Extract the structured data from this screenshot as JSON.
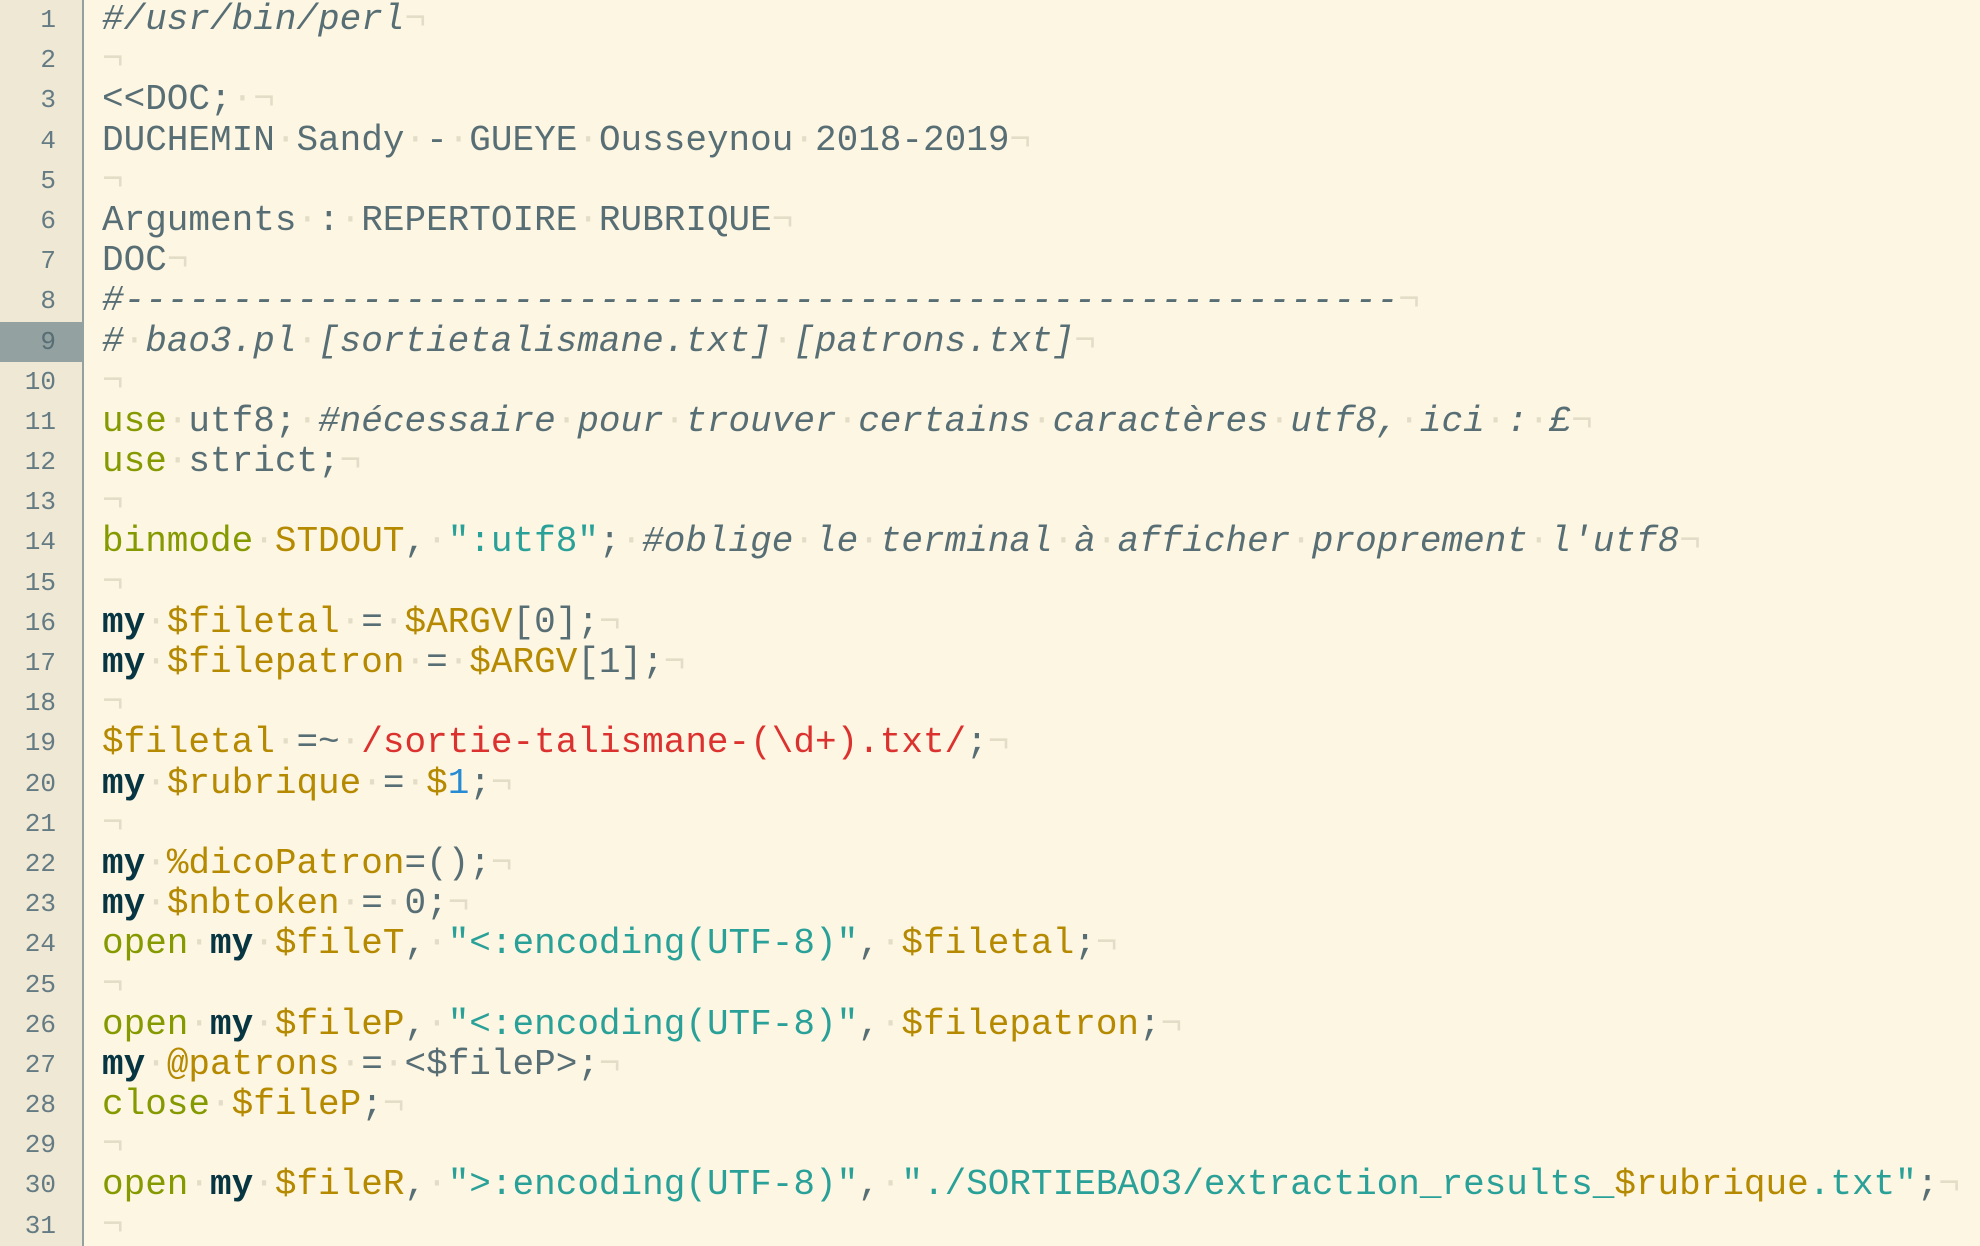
{
  "editor": {
    "current_line": 9,
    "invisible_space_glyph": "·",
    "invisible_eol_glyph": "¬",
    "colors": {
      "background": "#fdf6e3",
      "gutter": "#eee8d5",
      "current_line_gutter": "#93a1a1",
      "text": "#586e75",
      "keyword": "#859900",
      "declaration": "#073642",
      "variable": "#b58900",
      "string": "#2aa198",
      "regex": "#dc322f",
      "number": "#268bd2"
    },
    "lines": [
      [
        [
          "comment",
          "#/usr/bin/perl"
        ]
      ],
      [],
      [
        [
          "plain",
          "<<DOC; "
        ]
      ],
      [
        [
          "plain",
          "DUCHEMIN Sandy - GUEYE Ousseynou 2018-2019"
        ]
      ],
      [],
      [
        [
          "plain",
          "Arguments : REPERTOIRE RUBRIQUE"
        ]
      ],
      [
        [
          "plain",
          "DOC"
        ]
      ],
      [
        [
          "comment",
          "#-----------------------------------------------------------"
        ]
      ],
      [
        [
          "comment",
          "# bao3.pl [sortietalismane.txt] [patrons.txt]"
        ]
      ],
      [],
      [
        [
          "kw",
          "use"
        ],
        [
          "plain",
          " utf8; "
        ],
        [
          "comment",
          "#nécessaire pour trouver certains caractères utf8, ici : £"
        ]
      ],
      [
        [
          "kw",
          "use"
        ],
        [
          "plain",
          " strict;"
        ]
      ],
      [],
      [
        [
          "kw",
          "binmode"
        ],
        [
          "plain",
          " "
        ],
        [
          "var",
          "STDOUT"
        ],
        [
          "plain",
          ", "
        ],
        [
          "str",
          "\":utf8\""
        ],
        [
          "plain",
          "; "
        ],
        [
          "comment",
          "#oblige le terminal à afficher proprement l'utf8"
        ]
      ],
      [],
      [
        [
          "my",
          "my"
        ],
        [
          "plain",
          " "
        ],
        [
          "var",
          "$filetal"
        ],
        [
          "plain",
          " = "
        ],
        [
          "var",
          "$ARGV"
        ],
        [
          "plain",
          "[0];"
        ]
      ],
      [
        [
          "my",
          "my"
        ],
        [
          "plain",
          " "
        ],
        [
          "var",
          "$filepatron"
        ],
        [
          "plain",
          " = "
        ],
        [
          "var",
          "$ARGV"
        ],
        [
          "plain",
          "[1];"
        ]
      ],
      [],
      [
        [
          "var",
          "$filetal"
        ],
        [
          "plain",
          " =~ "
        ],
        [
          "re",
          "/sortie-talismane-(\\d+).txt/"
        ],
        [
          "plain",
          ";"
        ]
      ],
      [
        [
          "my",
          "my"
        ],
        [
          "plain",
          " "
        ],
        [
          "var",
          "$rubrique"
        ],
        [
          "plain",
          " = "
        ],
        [
          "var",
          "$"
        ],
        [
          "num",
          "1"
        ],
        [
          "plain",
          ";"
        ]
      ],
      [],
      [
        [
          "my",
          "my"
        ],
        [
          "plain",
          " "
        ],
        [
          "var",
          "%dicoPatron"
        ],
        [
          "plain",
          "=();"
        ]
      ],
      [
        [
          "my",
          "my"
        ],
        [
          "plain",
          " "
        ],
        [
          "var",
          "$nbtoken"
        ],
        [
          "plain",
          " = 0;"
        ]
      ],
      [
        [
          "kw",
          "open"
        ],
        [
          "plain",
          " "
        ],
        [
          "my",
          "my"
        ],
        [
          "plain",
          " "
        ],
        [
          "var",
          "$fileT"
        ],
        [
          "plain",
          ", "
        ],
        [
          "str",
          "\"<:encoding(UTF-8)\""
        ],
        [
          "plain",
          ", "
        ],
        [
          "var",
          "$filetal"
        ],
        [
          "plain",
          ";"
        ]
      ],
      [],
      [
        [
          "kw",
          "open"
        ],
        [
          "plain",
          " "
        ],
        [
          "my",
          "my"
        ],
        [
          "plain",
          " "
        ],
        [
          "var",
          "$fileP"
        ],
        [
          "plain",
          ", "
        ],
        [
          "str",
          "\"<:encoding(UTF-8)\""
        ],
        [
          "plain",
          ", "
        ],
        [
          "var",
          "$filepatron"
        ],
        [
          "plain",
          ";"
        ]
      ],
      [
        [
          "my",
          "my"
        ],
        [
          "plain",
          " "
        ],
        [
          "var",
          "@patrons"
        ],
        [
          "plain",
          " = <$fileP>;"
        ]
      ],
      [
        [
          "kw",
          "close"
        ],
        [
          "plain",
          " "
        ],
        [
          "var",
          "$fileP"
        ],
        [
          "plain",
          ";"
        ]
      ],
      [],
      [
        [
          "kw",
          "open"
        ],
        [
          "plain",
          " "
        ],
        [
          "my",
          "my"
        ],
        [
          "plain",
          " "
        ],
        [
          "var",
          "$fileR"
        ],
        [
          "plain",
          ", "
        ],
        [
          "str",
          "\">:encoding(UTF-8)\""
        ],
        [
          "plain",
          ", "
        ],
        [
          "str",
          "\"./SORTIEBAO3/extraction_results_"
        ],
        [
          "var",
          "$rubrique"
        ],
        [
          "str",
          ".txt\""
        ],
        [
          "plain",
          ";"
        ]
      ],
      []
    ]
  }
}
